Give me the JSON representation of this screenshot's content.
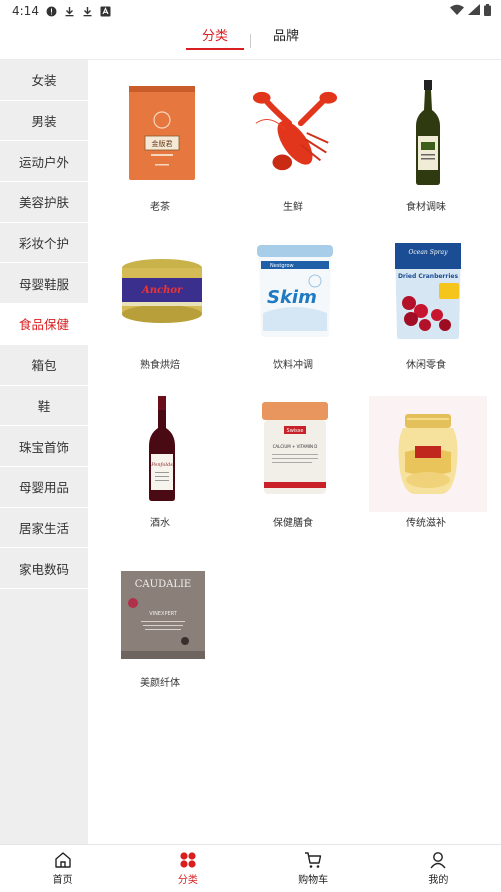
{
  "status_bar": {
    "time": "4:14",
    "icons": [
      "alert-icon",
      "download-icon",
      "download-icon",
      "app-icon"
    ],
    "right_icons": [
      "wifi-icon",
      "signal-icon",
      "battery-icon"
    ]
  },
  "top_tabs": [
    {
      "label": "分类",
      "active": true
    },
    {
      "label": "品牌",
      "active": false
    }
  ],
  "sidebar": {
    "items": [
      {
        "label": "女装"
      },
      {
        "label": "男装"
      },
      {
        "label": "运动户外"
      },
      {
        "label": "美容护肤"
      },
      {
        "label": "彩妆个护"
      },
      {
        "label": "母婴鞋服"
      },
      {
        "label": "食品保健",
        "active": true
      },
      {
        "label": "箱包"
      },
      {
        "label": "鞋"
      },
      {
        "label": "珠宝首饰"
      },
      {
        "label": "母婴用品"
      },
      {
        "label": "居家生活"
      },
      {
        "label": "家电数码"
      }
    ]
  },
  "products": [
    {
      "label": "老茶",
      "image": "tea-tin"
    },
    {
      "label": "生鲜",
      "image": "lobster"
    },
    {
      "label": "食材调味",
      "image": "olive-oil-bottle"
    },
    {
      "label": "熟食烘焙",
      "image": "butter-tin"
    },
    {
      "label": "饮料冲调",
      "image": "milk-powder-tub"
    },
    {
      "label": "休闲零食",
      "image": "cranberries-bag"
    },
    {
      "label": "酒水",
      "image": "wine-bottle"
    },
    {
      "label": "保健膳食",
      "image": "supplement-jar"
    },
    {
      "label": "传统滋补",
      "image": "birds-nest-jar"
    },
    {
      "label": "美颜纤体",
      "image": "beauty-supplement-box"
    }
  ],
  "product_texts": {
    "tea_brand": "金版君",
    "butter_brand": "Anchor",
    "milk_brand": "Skim",
    "milk_maker": "Nestgrow",
    "cranberry_brand": "Ocean Spray",
    "cranberry_name": "Dried Cranberries",
    "cranberry_badge": "ORIGINAL",
    "wine_brand": "Penfolds",
    "supplement_brand": "Swisse",
    "supplement_name": "CALCIUM + VITAMIN D",
    "beauty_brand": "CAUDALIE",
    "beauty_name": "VINEXPERT"
  },
  "bottom_nav": [
    {
      "label": "首页",
      "icon": "home-icon"
    },
    {
      "label": "分类",
      "icon": "category-icon",
      "active": true
    },
    {
      "label": "购物车",
      "icon": "cart-icon"
    },
    {
      "label": "我的",
      "icon": "profile-icon"
    }
  ],
  "colors": {
    "accent": "#d81e1e",
    "sidebar_bg": "#eeeeee"
  }
}
